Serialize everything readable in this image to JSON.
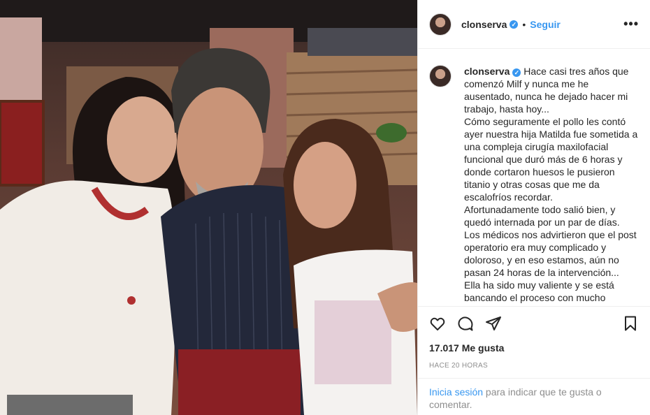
{
  "post": {
    "username": "clonserva",
    "verified_mark": "✓",
    "separator": "•",
    "follow_label": "Seguir",
    "more_label": "•••",
    "caption_text": "Hace casi tres años que comenzó Milf y nunca me he ausentado, nunca he dejado hacer mi trabajo, hasta hoy...\nCómo seguramente el pollo les contó ayer nuestra hija Matilda fue sometida a una compleja cirugía maxilofacial funcional que duró más de 6 horas y donde cortaron huesos le pusieron titanio y otras cosas que me da escalofríos recordar.\nAfortunadamente todo salió bien, y quedó internada por un par de días.\nLos médicos nos advirtieron que el post operatorio era muy complicado y doloroso, y en eso estamos, aún no pasan 24 horas de la intervención...\nElla ha sido muy valiente y se está bancando el proceso con mucho",
    "likes": "17.017 Me gusta",
    "timestamp": "HACE 20 HORAS",
    "login_link": "Inicia sesión",
    "login_text": " para indicar que te gusta o comentar."
  },
  "icons": [
    "heart-icon",
    "comment-icon",
    "share-icon",
    "bookmark-icon",
    "more-options-icon",
    "verified-badge-icon"
  ],
  "colors": {
    "accent": "#3897f0",
    "text": "#262626",
    "muted": "#8e8e8e",
    "border": "#efefef"
  }
}
